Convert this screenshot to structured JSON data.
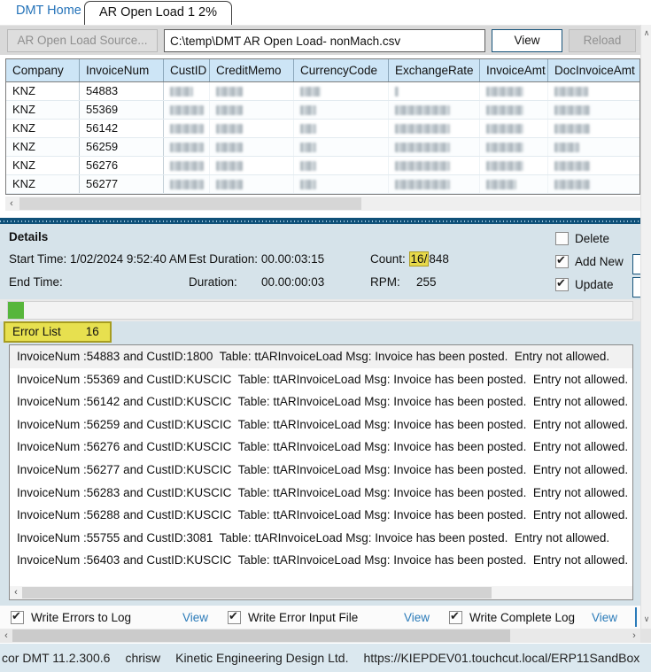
{
  "tabs": {
    "home_label": "DMT Home",
    "active_label": "AR Open Load 1 2%"
  },
  "toolbar": {
    "source_button": "AR Open Load Source...",
    "file_path": "C:\\temp\\DMT AR Open Load- nonMach.csv",
    "view_button": "View",
    "reload_button": "Reload"
  },
  "grid": {
    "columns": [
      "Company",
      "InvoiceNum",
      "CustID",
      "CreditMemo",
      "CurrencyCode",
      "ExchangeRate",
      "InvoiceAmt",
      "DocInvoiceAmt"
    ],
    "rows": [
      {
        "company": "KNZ",
        "invoice_num": "54883"
      },
      {
        "company": "KNZ",
        "invoice_num": "55369"
      },
      {
        "company": "KNZ",
        "invoice_num": "56142"
      },
      {
        "company": "KNZ",
        "invoice_num": "56259"
      },
      {
        "company": "KNZ",
        "invoice_num": "56276"
      },
      {
        "company": "KNZ",
        "invoice_num": "56277"
      }
    ]
  },
  "details": {
    "title": "Details",
    "start_time_label": "Start Time:",
    "start_time_value": "1/02/2024 9:52:40 AM",
    "est_duration_label": "Est Duration:",
    "est_duration_value": "00.00:03:15",
    "count_label": "Count:",
    "count_current": "16/",
    "count_total": "848",
    "end_time_label": "End Time:",
    "end_time_value": "",
    "duration_label": "Duration:",
    "duration_value": "00.00:00:03",
    "rpm_label": "RPM:",
    "rpm_value": "255",
    "checkboxes": [
      {
        "label": "Delete",
        "checked": false
      },
      {
        "label": "Add New",
        "checked": true
      },
      {
        "label": "Update",
        "checked": true
      }
    ]
  },
  "error_list": {
    "label": "Error List",
    "count": "16",
    "items": [
      "InvoiceNum :54883 and CustID:1800  Table: ttARInvoiceLoad Msg: Invoice has been posted.  Entry not allowed.",
      "InvoiceNum :55369 and CustID:KUSCIC  Table: ttARInvoiceLoad Msg: Invoice has been posted.  Entry not allowed.",
      "InvoiceNum :56142 and CustID:KUSCIC  Table: ttARInvoiceLoad Msg: Invoice has been posted.  Entry not allowed.",
      "InvoiceNum :56259 and CustID:KUSCIC  Table: ttARInvoiceLoad Msg: Invoice has been posted.  Entry not allowed.",
      "InvoiceNum :56276 and CustID:KUSCIC  Table: ttARInvoiceLoad Msg: Invoice has been posted.  Entry not allowed.",
      "InvoiceNum :56277 and CustID:KUSCIC  Table: ttARInvoiceLoad Msg: Invoice has been posted.  Entry not allowed.",
      "InvoiceNum :56283 and CustID:KUSCIC  Table: ttARInvoiceLoad Msg: Invoice has been posted.  Entry not allowed.",
      "InvoiceNum :56288 and CustID:KUSCIC  Table: ttARInvoiceLoad Msg: Invoice has been posted.  Entry not allowed.",
      "InvoiceNum :55755 and CustID:3081  Table: ttARInvoiceLoad Msg: Invoice has been posted.  Entry not allowed.",
      "InvoiceNum :56403 and CustID:KUSCIC  Table: ttARInvoiceLoad Msg: Invoice has been posted.  Entry not allowed."
    ]
  },
  "footer": {
    "options": [
      {
        "label": "Write Errors to Log",
        "checked": true,
        "view_label": "View"
      },
      {
        "label": "Write Error Input File",
        "checked": true,
        "view_label": "View"
      },
      {
        "label": "Write Complete Log",
        "checked": true,
        "view_label": "View"
      }
    ]
  },
  "status_bar": {
    "app_version": "cor DMT 11.2.300.6",
    "user": "chrisw",
    "company": "Kinetic Engineering Design Ltd.",
    "environment_url": "https://KIEPDEV01.touchcut.local/ERP11SandBox"
  },
  "colors": {
    "accent_blue": "#2b7bb9",
    "splitter_blue": "#0f5078",
    "grid_header_blue": "#cde5f6",
    "highlight_yellow": "#e7dd4d",
    "progress_green": "#57b63b",
    "panel_blue": "#d6e3ea"
  }
}
